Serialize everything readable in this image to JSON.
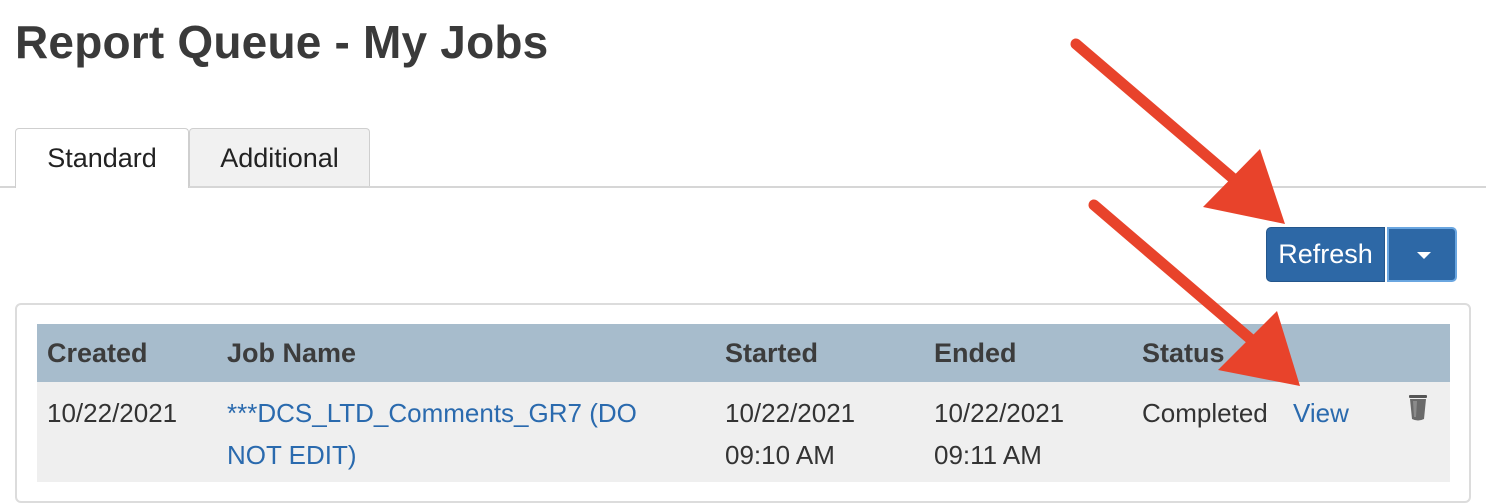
{
  "page": {
    "title": "Report Queue - My Jobs"
  },
  "tabs": [
    {
      "label": "Standard",
      "active": true
    },
    {
      "label": "Additional",
      "active": false
    }
  ],
  "toolbar": {
    "refresh_label": "Refresh"
  },
  "table": {
    "headers": [
      "Created",
      "Job Name",
      "Started",
      "Ended",
      "Status"
    ],
    "rows": [
      {
        "created": "10/22/2021",
        "job_name_line1": "***DCS_LTD_Comments_GR7 (DO",
        "job_name_line2": "NOT EDIT)",
        "started_line1": "10/22/2021",
        "started_line2": "09:10 AM",
        "ended_line1": "10/22/2021",
        "ended_line2": "09:11 AM",
        "status": "Completed",
        "view_label": "View"
      }
    ]
  },
  "colors": {
    "header_bg": "#a7bccc",
    "button_bg": "#2d68a6",
    "link": "#2a6aae",
    "annotation_arrow": "#e8432b"
  },
  "icons": {
    "dropdown": "caret-down-icon",
    "delete": "trash-icon"
  }
}
